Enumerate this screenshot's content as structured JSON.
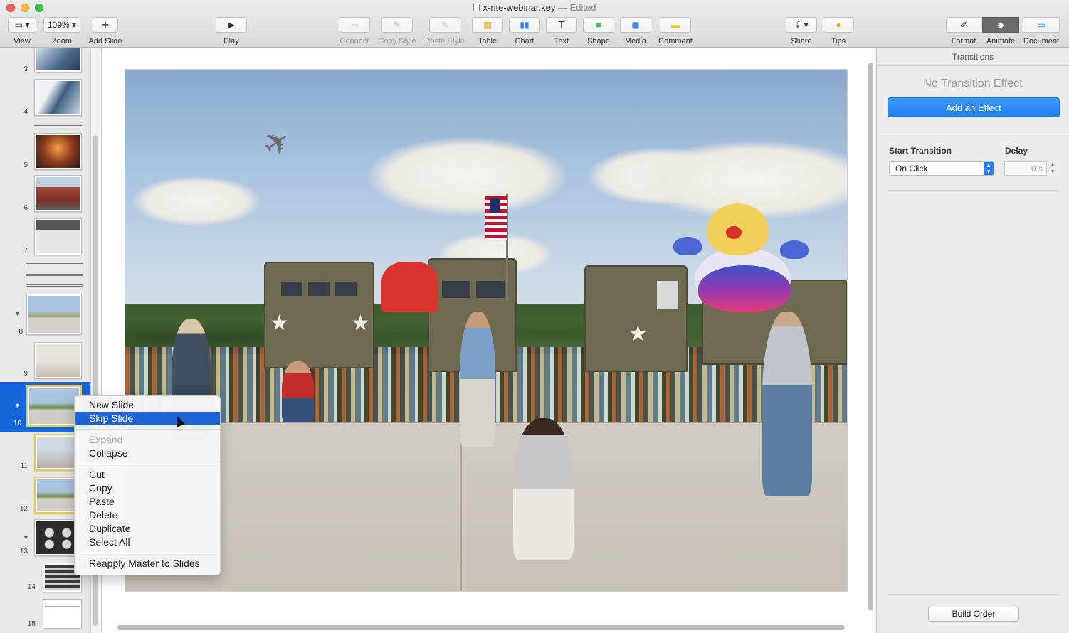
{
  "window": {
    "title": "x-rite-webinar.key",
    "title_sep": "—",
    "status": "Edited"
  },
  "toolbar": {
    "view": "View",
    "zoom_value": "109%",
    "zoom": "Zoom",
    "add_slide": "Add Slide",
    "play": "Play",
    "connect": "Connect",
    "copy_style": "Copy Style",
    "paste_style": "Paste Style",
    "table": "Table",
    "chart": "Chart",
    "text": "Text",
    "shape": "Shape",
    "media": "Media",
    "comment": "Comment",
    "share": "Share",
    "tips": "Tips",
    "format": "Format",
    "animate": "Animate",
    "document": "Document"
  },
  "navigator": {
    "slides": [
      {
        "num": "3"
      },
      {
        "num": "4"
      },
      {
        "num": "5"
      },
      {
        "num": "6"
      },
      {
        "num": "7"
      },
      {
        "num": "8"
      },
      {
        "num": "9"
      },
      {
        "num": "10"
      },
      {
        "num": "11"
      },
      {
        "num": "12"
      },
      {
        "num": "13"
      },
      {
        "num": "14"
      },
      {
        "num": "15"
      }
    ]
  },
  "context_menu": {
    "items": [
      "New Slide",
      "Skip Slide",
      "Expand",
      "Collapse",
      "Cut",
      "Copy",
      "Paste",
      "Delete",
      "Duplicate",
      "Select All",
      "Reapply Master to Slides"
    ]
  },
  "inspector": {
    "header": "Transitions",
    "no_effect": "No Transition Effect",
    "add_effect": "Add an Effect",
    "start_transition_label": "Start Transition",
    "start_transition_value": "On Click",
    "delay_label": "Delay",
    "delay_value": "0 s",
    "build_order": "Build Order"
  },
  "colors": {
    "accent": "#1c64d6",
    "skipped_border": "#e3cc5a"
  }
}
